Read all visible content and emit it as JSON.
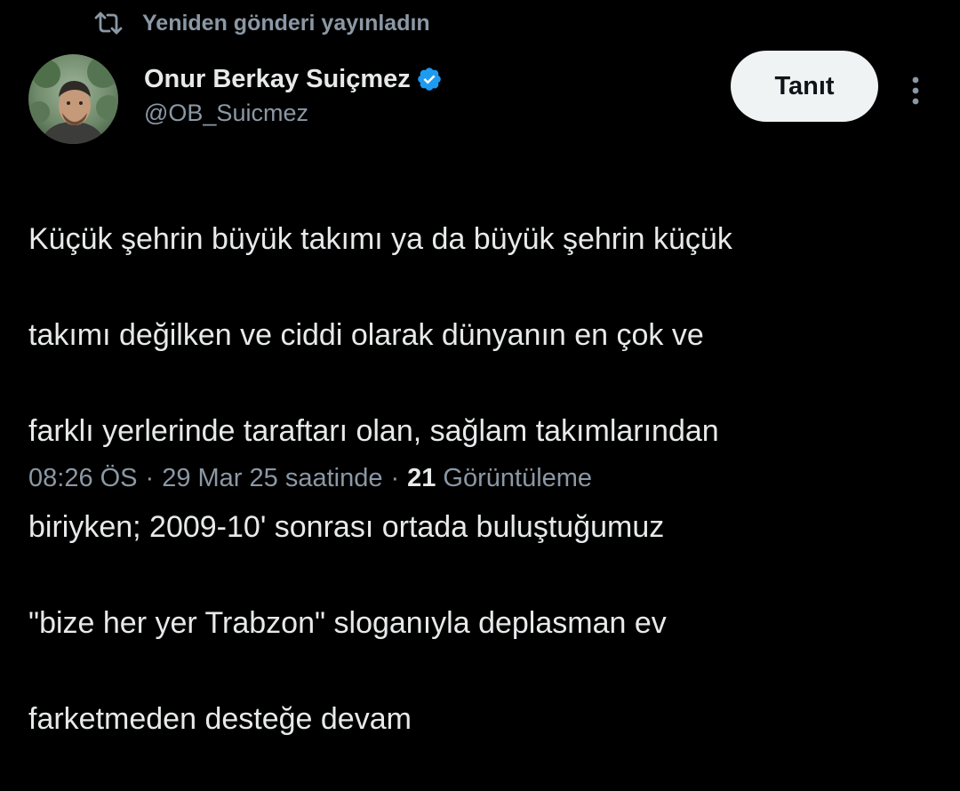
{
  "repost": {
    "icon": "retweet-icon",
    "label": "Yeniden gönderi yayınladın"
  },
  "author": {
    "avatar_icon": "profile-photo",
    "display_name": "Onur Berkay Suiçmez",
    "verified_icon": "verified-badge-icon",
    "handle": "@OB_Suicmez"
  },
  "actions": {
    "follow_label": "Tanıt",
    "more_icon": "more-vertical-icon"
  },
  "tweet": {
    "text_lines": [
      "Küçük şehrin büyük takımı ya da büyük şehrin küçük",
      "takımı değilken ve ciddi olarak dünyanın en çok ve",
      "farklı yerlerinde taraftarı olan, sağlam takımlarından",
      "biriyken; 2009-10' sonrası ortada buluştuğumuz",
      "\"bize her yer Trabzon\" sloganıyla deplasman ev",
      "farketmeden desteğe devam"
    ]
  },
  "meta": {
    "time": "08:26 ÖS",
    "separator": "·",
    "date": "29 Mar 25 saatinde",
    "views_count": "21",
    "views_label": "Görüntüleme"
  },
  "colors": {
    "background": "#000000",
    "primary_text": "#e7e9ea",
    "secondary_text": "#8b98a5",
    "verified_blue": "#1d9bf0",
    "button_bg": "#eff3f4"
  }
}
